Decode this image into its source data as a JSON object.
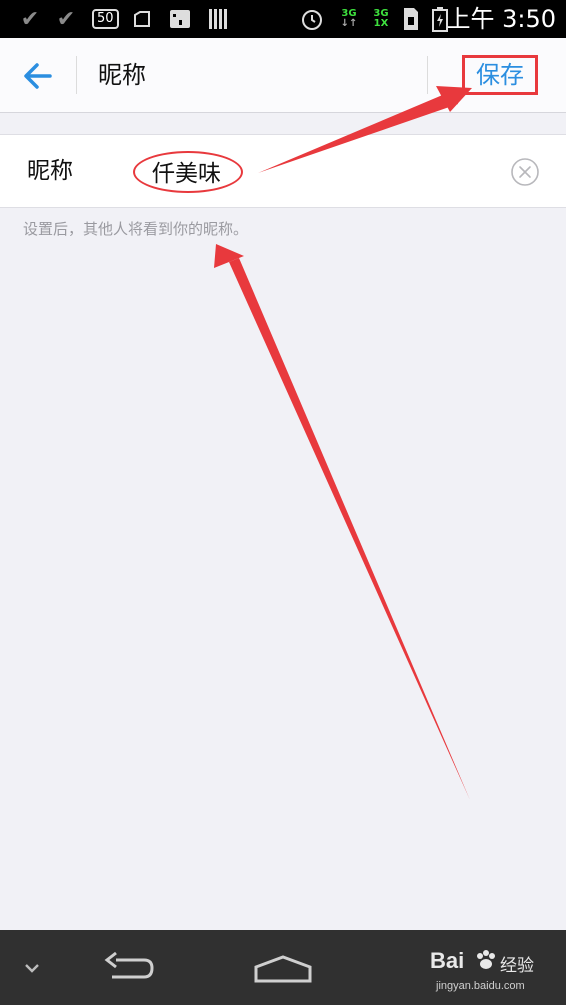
{
  "status_bar": {
    "badge": "50",
    "net1": "3G",
    "net2_top": "3G",
    "net2_bottom": "1X",
    "time": "上午 3:50"
  },
  "header": {
    "title": "昵称",
    "save_label": "保存"
  },
  "nickname": {
    "label": "昵称",
    "value": "仟美味",
    "hint": "设置后，其他人将看到你的昵称。"
  },
  "watermark": {
    "brand": "Bai",
    "brand_suffix": "经验",
    "url": "jingyan.baidu.com"
  },
  "colors": {
    "accent": "#2b8ee0",
    "annotation": "#e8393d"
  }
}
